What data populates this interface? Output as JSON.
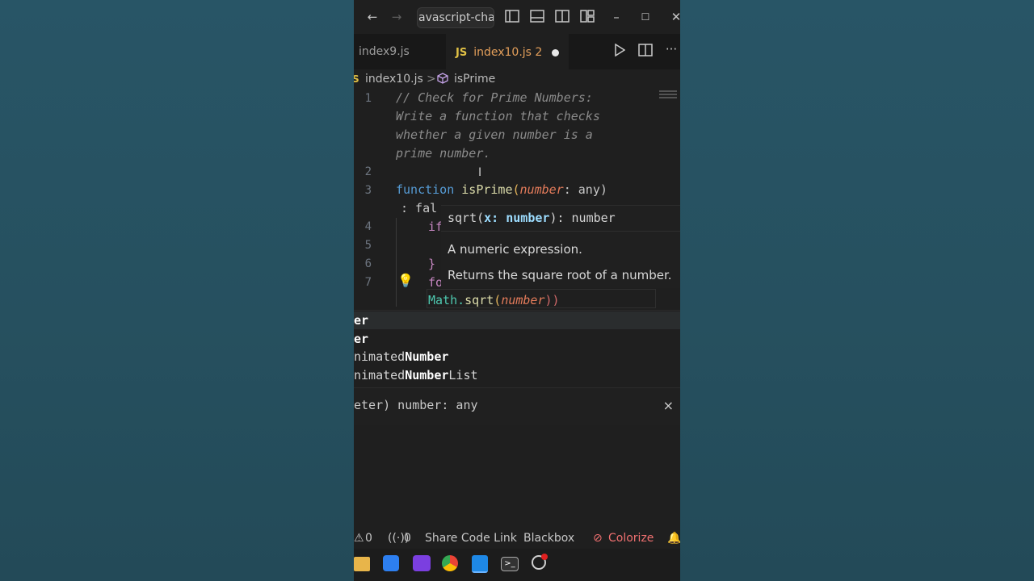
{
  "titlebar": {
    "search_text": "avascript-chall"
  },
  "tabs": [
    {
      "label": "index9.js"
    },
    {
      "badge": "JS",
      "label": "index10.js 2"
    }
  ],
  "breadcrumb": {
    "file": "index10.js",
    "separator": ">",
    "symbol": "isPrime"
  },
  "editor": {
    "line_numbers": [
      "1",
      "2",
      "3",
      "4",
      "5",
      "6",
      "7"
    ],
    "comment_lines": [
      "// Check for Prime Numbers:",
      "Write a function that checks",
      "whether a given number is a",
      "prime number."
    ],
    "line3": {
      "kw": "function",
      "fn": "isPrime",
      "param": "number",
      "type": ": any)"
    },
    "line3_wrap": ": fal",
    "line4_frag": "if",
    "line6_frag": "}",
    "line7_frag": "fo",
    "line8": {
      "obj": "Math.",
      "fn": "sqrt",
      "open": "(",
      "param": "number",
      "close": "))"
    }
  },
  "hover": {
    "sig_fn": "sqrt(",
    "sig_param": "x: number",
    "sig_ret": "): number",
    "line1": "A numeric expression.",
    "line2": "Returns the square root of a number."
  },
  "suggestions": {
    "items": [
      {
        "pre": "",
        "bold": "er",
        "post": ""
      },
      {
        "pre": "",
        "bold": "er",
        "post": ""
      },
      {
        "pre": "nimated",
        "bold": "Number",
        "post": ""
      },
      {
        "pre": "nimated",
        "bold": "Number",
        "post": "List"
      }
    ],
    "detail": "eter) number: any",
    "close_icon": "×"
  },
  "statusbar": {
    "warnings": "0",
    "ports": "0",
    "share": "Share Code Link",
    "blackbox": "Blackbox",
    "colorize": "Colorize"
  },
  "colors": {
    "background": "#26505f",
    "editor_bg": "#1f1f1f",
    "accent_orange": "#e5a05b",
    "keyword": "#569cd6",
    "function": "#dcdcaa",
    "parameter": "#e57c5b"
  }
}
